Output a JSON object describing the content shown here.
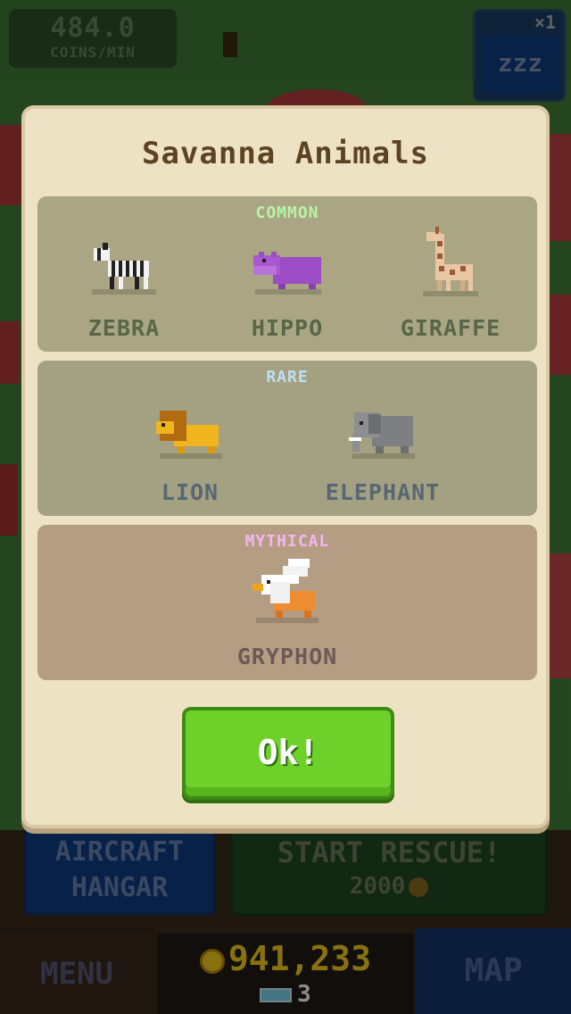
{
  "hud": {
    "coins_per_min_value": "484.0",
    "coins_per_min_label": "COINS/MIN",
    "sleep_multiplier": "×1",
    "sleep_icon_text": "zzz"
  },
  "actions": {
    "aircraft_hangar_line1": "AIRCRAFT",
    "aircraft_hangar_line2": "HANGAR",
    "start_rescue_label": "START RESCUE!",
    "start_rescue_cost": "2000"
  },
  "bottom_bar": {
    "menu_label": "MENU",
    "coin_balance": "941,233",
    "gem_count": "3",
    "map_label": "MAP"
  },
  "modal": {
    "title": "Savanna Animals",
    "sections": [
      {
        "rarity": "COMMON",
        "animals": [
          "ZEBRA",
          "HIPPO",
          "GIRAFFE"
        ]
      },
      {
        "rarity": "RARE",
        "animals": [
          "LION",
          "ELEPHANT"
        ]
      },
      {
        "rarity": "MYTHICAL",
        "animals": [
          "GRYPHON"
        ]
      }
    ],
    "ok_label": "Ok!"
  },
  "colors": {
    "modal_bg": "#eee2c5",
    "common_label": "#b8f3a8",
    "rare_label": "#bde0f3",
    "mythical_label": "#f2b6f2",
    "ok_button": "#6ed12a",
    "coin_gold": "#f6cf1c"
  }
}
